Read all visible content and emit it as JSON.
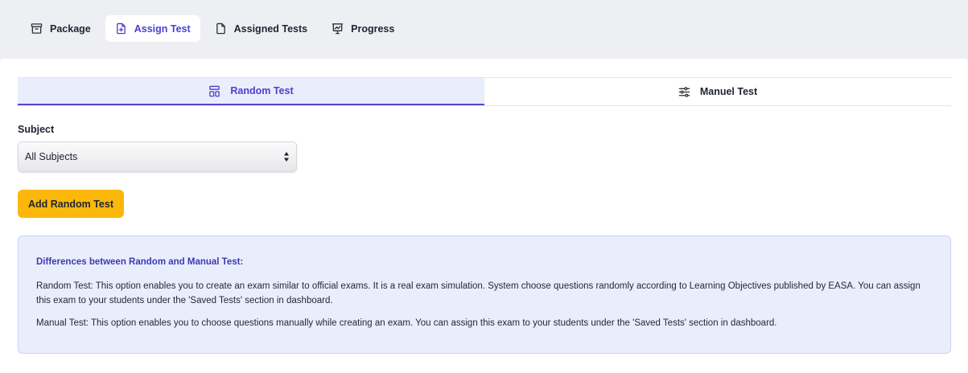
{
  "nav": {
    "tabs": [
      {
        "label": "Package",
        "icon": "archive-icon",
        "active": false
      },
      {
        "label": "Assign Test",
        "icon": "file-plus-icon",
        "active": true
      },
      {
        "label": "Assigned Tests",
        "icon": "file-icon",
        "active": false
      },
      {
        "label": "Progress",
        "icon": "presentation-chart-icon",
        "active": false
      }
    ]
  },
  "test_tabs": [
    {
      "label": "Random Test",
      "icon": "layout-icon",
      "active": true
    },
    {
      "label": "Manuel Test",
      "icon": "sliders-icon",
      "active": false
    }
  ],
  "form": {
    "subject_label": "Subject",
    "subject_value": "All Subjects",
    "add_button": "Add Random Test"
  },
  "info": {
    "title": "Differences between Random and Manual Test:",
    "random": "Random Test: This option enables you to create an exam similar to official exams. It is a real exam simulation. System choose questions randomly according to Learning Objectives published by EASA. You can assign this exam to your students under the 'Saved Tests' section in dashboard.",
    "manual": "Manual Test: This option enables you to choose questions manually while creating an exam. You can assign this exam to your students under the 'Saved Tests' section in dashboard."
  },
  "colors": {
    "accent": "#4b3fd1",
    "button": "#fbb80b",
    "info_bg": "#eaeefc",
    "page_bg": "#eeeff3"
  }
}
